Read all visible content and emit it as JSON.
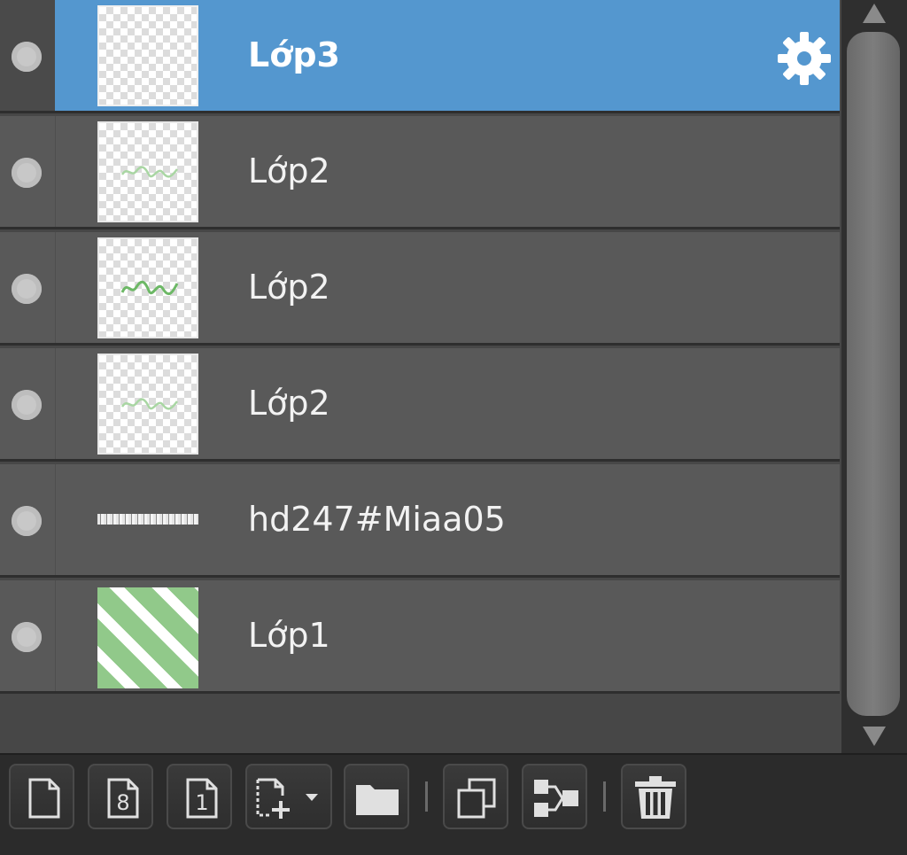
{
  "layers": [
    {
      "name": "Lớp3",
      "selected": true,
      "thumb": "empty"
    },
    {
      "name": "Lớp2",
      "selected": false,
      "thumb": "faint-scribble"
    },
    {
      "name": "Lớp2",
      "selected": false,
      "thumb": "scribble"
    },
    {
      "name": "Lớp2",
      "selected": false,
      "thumb": "faint-scribble"
    },
    {
      "name": "hd247#Miaa05",
      "selected": false,
      "thumb": "text-strip"
    },
    {
      "name": "Lớp1",
      "selected": false,
      "thumb": "green-stripes"
    }
  ],
  "colors": {
    "selected_row": "#5497cf",
    "row_bg": "#595959",
    "panel_bg": "#474747",
    "toolbar_bg": "#2b2b2b",
    "scribble_green": "#7fbf7a",
    "stripe_green": "#91c98a"
  },
  "toolbar": {
    "buttons": [
      {
        "icon": "new-layer-icon"
      },
      {
        "icon": "new-8bit-layer-icon",
        "glyph": "8"
      },
      {
        "icon": "new-1bit-layer-icon",
        "glyph": "1"
      },
      {
        "icon": "add-layer-menu-icon"
      },
      {
        "icon": "folder-icon"
      },
      {
        "icon": "duplicate-layer-icon"
      },
      {
        "icon": "merge-down-icon"
      },
      {
        "icon": "trash-icon"
      }
    ]
  }
}
